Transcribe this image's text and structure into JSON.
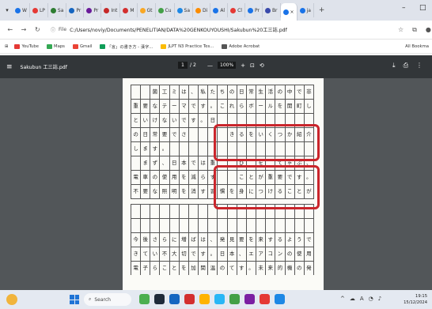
{
  "browser": {
    "tabs": [
      {
        "label": "W",
        "color": "#1a73e8"
      },
      {
        "label": "LP",
        "color": "#e53935"
      },
      {
        "label": "Sa",
        "color": "#2e7d32"
      },
      {
        "label": "Pr",
        "color": "#1565c0"
      },
      {
        "label": "Pr",
        "color": "#6a1b9a"
      },
      {
        "label": "Int",
        "color": "#c62828"
      },
      {
        "label": "M",
        "color": "#d32f2f"
      },
      {
        "label": "Gt",
        "color": "#f9a825"
      },
      {
        "label": "Cu",
        "color": "#43a047"
      },
      {
        "label": "Sa",
        "color": "#1e88e5"
      },
      {
        "label": "Di",
        "color": "#fb8c00"
      },
      {
        "label": "Al",
        "color": "#1a73e8"
      },
      {
        "label": "Cl",
        "color": "#e53935"
      },
      {
        "label": "Pr",
        "color": "#1a73e8"
      },
      {
        "label": "Br",
        "color": "#3949ab"
      }
    ],
    "active_tab_close": "×",
    "tab_after": "ja",
    "new_tab": "+",
    "window_min": "–",
    "window_max": "□",
    "url_prefix": "File",
    "url": "C:/Users/noviy/Documents/PENELITIAN/DATA%20GENKOUYOUSHI/Sakubun%20工三誌.pdf",
    "bookmarks": [
      {
        "label": "YouTube",
        "color": "#e53935"
      },
      {
        "label": "Maps",
        "color": "#34a853"
      },
      {
        "label": "Gmail",
        "color": "#ea4335"
      },
      {
        "label": "「言」の書き方 - 漢字...",
        "color": "#0f9d58"
      },
      {
        "label": "JLPT N3 Practice Tes...",
        "color": "#fbbc05"
      },
      {
        "label": "Adobe Acrobat",
        "color": "#555555"
      }
    ],
    "all_bookmarks": "All Bookma"
  },
  "pdf": {
    "title": "Sakubun 工三誌.pdf",
    "page_current": "1",
    "page_total": "/ 2",
    "zoom": "100%",
    "zoom_minus": "—",
    "zoom_plus": "+"
  },
  "manuscript": {
    "rows": [
      [
        "",
        "",
        "菌",
        "工",
        "ミ",
        "は",
        "、",
        "私",
        "た",
        "ち",
        "の",
        "日",
        "常",
        "生",
        "活",
        "の",
        "中",
        "で",
        "非"
      ],
      [
        "重",
        "要",
        "な",
        "テ",
        "ー",
        "マ",
        "で",
        "す",
        "。",
        "こ",
        "れ",
        "ら",
        "ボ",
        "ー",
        "ル",
        "を",
        "開",
        "町",
        "し"
      ],
      [
        "と",
        "い",
        "け",
        "な",
        "い",
        "で",
        "す",
        "。",
        "日",
        "",
        "",
        "",
        "",
        "",
        "",
        "",
        "",
        "",
        ""
      ],
      [
        "の",
        "日",
        "常",
        "要",
        "で",
        "さ",
        "",
        "",
        "",
        "",
        "き",
        "る",
        "を",
        "い",
        "く",
        "つ",
        "か",
        "紹",
        "介"
      ],
      [
        "し",
        "ま",
        "す",
        "。",
        "",
        "",
        "",
        "",
        "",
        "",
        "",
        "",
        "",
        "",
        "",
        "",
        "",
        "",
        ""
      ],
      [
        "",
        "ま",
        "ず",
        "、",
        "日",
        "本",
        "で",
        "は",
        "重",
        "",
        "",
        "び",
        "",
        "を",
        "",
        "て",
        "ゃ",
        "ぶ",
        "、"
      ],
      [
        "電",
        "車",
        "の",
        "使",
        "用",
        "を",
        "減",
        "ら",
        "す",
        "",
        "",
        "こ",
        "と",
        "が",
        "重",
        "要",
        "で",
        "す",
        "。"
      ],
      [
        "不",
        "要",
        "な",
        "照",
        "明",
        "を",
        "消",
        "す",
        "習",
        "慣",
        "を",
        "身",
        "に",
        "つ",
        "け",
        "る",
        "こ",
        "と",
        "が"
      ],
      [
        "",
        "",
        "",
        "",
        "",
        "",
        "",
        "",
        "",
        "",
        "",
        "",
        "",
        "",
        "",
        "",
        "",
        "",
        ""
      ],
      [
        "",
        "",
        "",
        "",
        "",
        "",
        "",
        "",
        "",
        "",
        "",
        "",
        "",
        "",
        "",
        "",
        "",
        "",
        ""
      ],
      [
        "今",
        "後",
        "さ",
        "ら",
        "に",
        "増",
        "ば",
        "は",
        "、",
        "発",
        "見",
        "要",
        "を",
        "来",
        "す",
        "る",
        "よ",
        "う",
        "で"
      ],
      [
        "き",
        "て",
        "い",
        "不",
        "大",
        "切",
        "で",
        "す",
        "。",
        "日",
        "本",
        "、",
        "エ",
        "ア",
        "コ",
        "ン",
        "の",
        "使",
        "用"
      ],
      [
        "電",
        "子",
        "ら",
        "こ",
        "と",
        "を",
        "加",
        "関",
        "温",
        "の",
        "て",
        "す",
        "。",
        "未",
        "来",
        "的",
        "機",
        "の",
        "発"
      ]
    ],
    "gap_after_row": 8
  },
  "taskbar": {
    "search_placeholder": "Search",
    "lang": "A",
    "time": "19:15",
    "date": "15/12/2024",
    "apps": [
      "#4caf50",
      "#1e2a3a",
      "#1565c0",
      "#d32f2f",
      "#ffb300",
      "#29b6f6",
      "#43a047",
      "#7b1fa2",
      "#e53935",
      "#1e88e5"
    ]
  }
}
